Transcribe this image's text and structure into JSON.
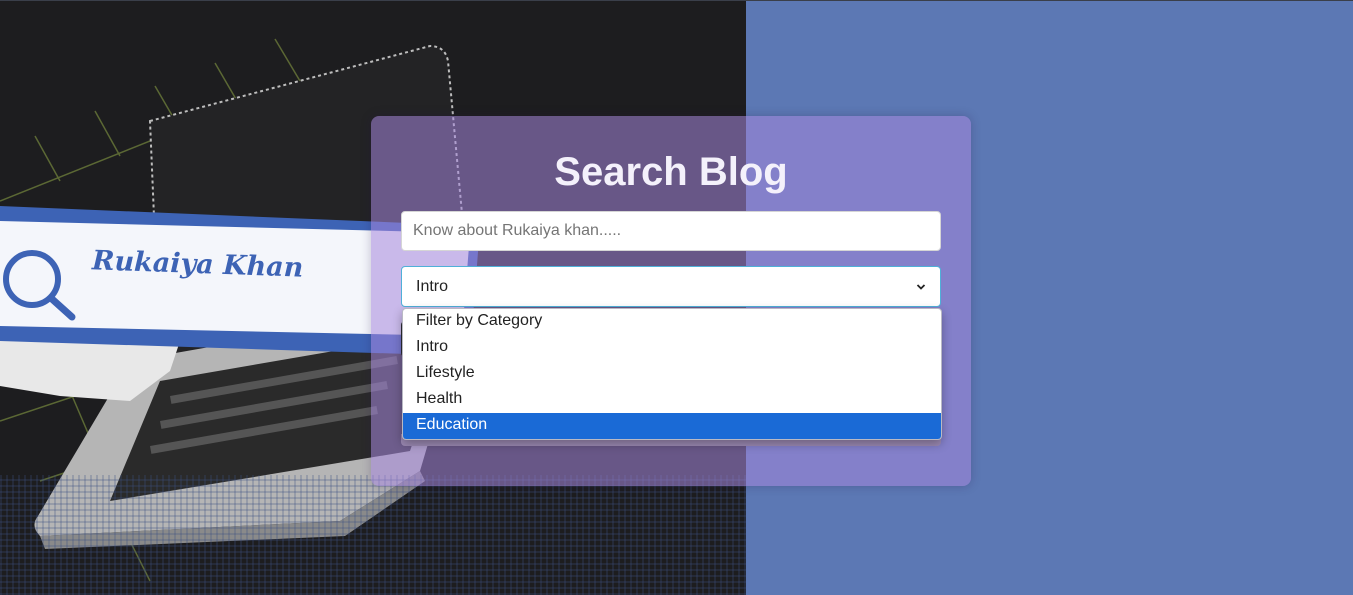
{
  "hero": {
    "brand_text": "Rukaiya Khan"
  },
  "search": {
    "title": "Search Blog",
    "input_placeholder": "Know about Rukaiya khan.....",
    "input_value": "",
    "category_selected": "Intro",
    "category_options": [
      "Filter by Category",
      "Intro",
      "Lifestyle",
      "Health",
      "Education"
    ],
    "highlighted_option": "Education"
  },
  "colors": {
    "accent_blue": "#5c78b4",
    "card_purple": "#a687dc",
    "option_highlight": "#1a6ad6"
  }
}
